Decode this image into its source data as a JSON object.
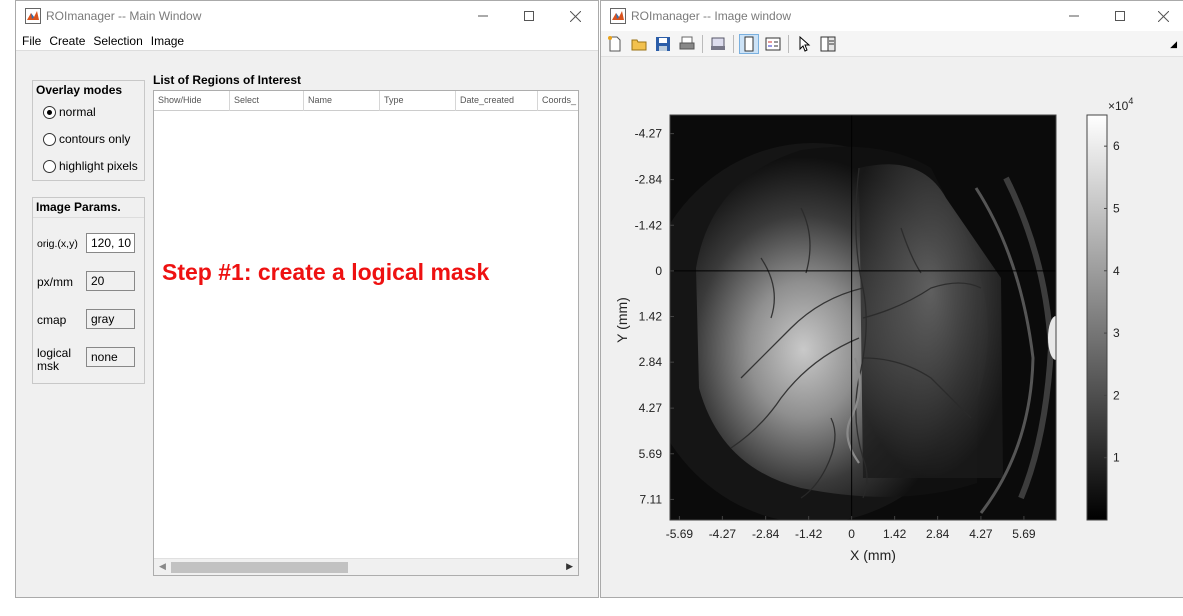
{
  "main_window": {
    "title": "ROImanager -- Main Window",
    "menu": [
      "File",
      "Create",
      "Selection",
      "Image"
    ],
    "overlay_modes": {
      "title": "Overlay modes",
      "options": [
        {
          "label": "normal",
          "selected": true
        },
        {
          "label": "contours only",
          "selected": false
        },
        {
          "label": "highlight pixels",
          "selected": false
        }
      ]
    },
    "image_params": {
      "title": "Image Params.",
      "fields": [
        {
          "label": "orig.(x,y)",
          "value": "120, 10"
        },
        {
          "label": "px/mm",
          "value": "20"
        },
        {
          "label": "cmap",
          "value": "gray"
        },
        {
          "label": "logical msk",
          "value": "none"
        }
      ]
    },
    "roi_list": {
      "title": "List of Regions of Interest",
      "columns": [
        "Show/Hide",
        "Select",
        "Name",
        "Type",
        "Date_created",
        "Coords_"
      ]
    },
    "annotation": "Step #1: create a logical mask"
  },
  "image_window": {
    "title": "ROImanager -- Image window",
    "toolbar_icons": [
      "new-figure-icon",
      "open-file-icon",
      "save-icon",
      "print-icon",
      "print-figure-icon",
      "colorbar-toggle-icon",
      "legend-toggle-icon",
      "pointer-icon",
      "property-editor-icon"
    ]
  },
  "chart_data": {
    "type": "heatmap",
    "xlabel": "X (mm)",
    "ylabel": "Y (mm)",
    "x_ticks": [
      "-5.69",
      "-4.27",
      "-2.84",
      "-1.42",
      "0",
      "1.42",
      "2.84",
      "4.27",
      "5.69"
    ],
    "y_ticks": [
      "-4.27",
      "-2.84",
      "-1.42",
      "0",
      "1.42",
      "2.84",
      "4.27",
      "5.69",
      "7.11"
    ],
    "xlim": [
      -6.0,
      6.75
    ],
    "ylim": [
      -4.85,
      7.75
    ],
    "colormap": "gray",
    "colorbar": {
      "ticks": [
        "1",
        "2",
        "3",
        "4",
        "5",
        "6"
      ],
      "tick_values": [
        1,
        2,
        3,
        4,
        5,
        6
      ],
      "range": [
        0,
        6.5
      ],
      "multiplier_base": "×10",
      "multiplier_exp": "4"
    },
    "crosshair": {
      "x": 0,
      "y": 0
    },
    "colors": {
      "crosshair": "#000000"
    }
  }
}
